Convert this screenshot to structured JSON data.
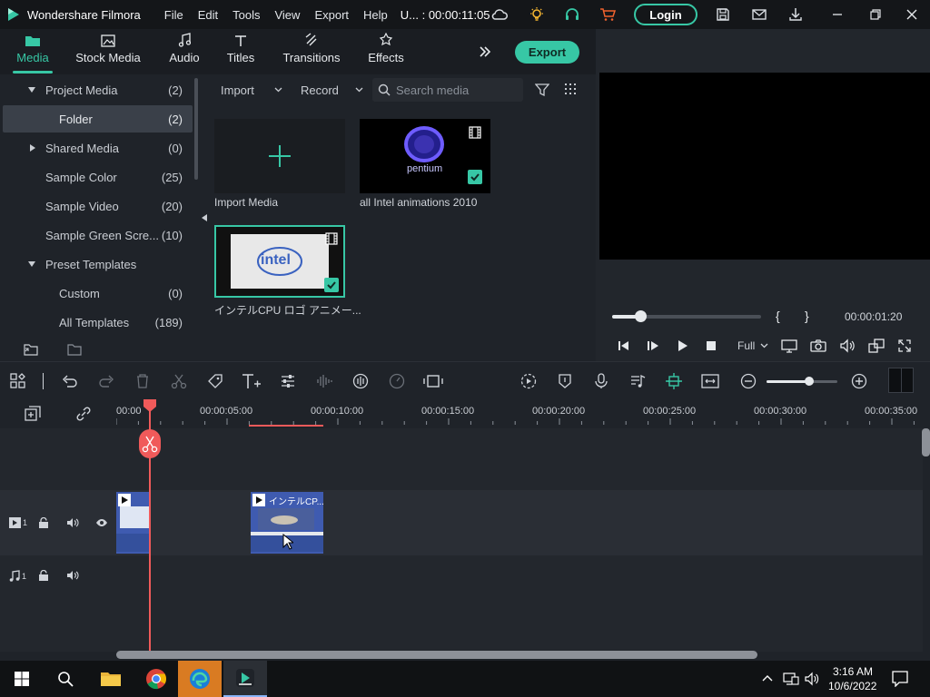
{
  "titlebar": {
    "app_name": "Wondershare Filmora",
    "menu": [
      "File",
      "Edit",
      "Tools",
      "View",
      "Export",
      "Help"
    ],
    "project_timecode": "U... : 00:00:11:05",
    "login_label": "Login"
  },
  "tabs": [
    {
      "label": "Media",
      "icon": "folder-icon",
      "active": true
    },
    {
      "label": "Stock Media",
      "icon": "image-icon",
      "active": false
    },
    {
      "label": "Audio",
      "icon": "music-note-icon",
      "active": false
    },
    {
      "label": "Titles",
      "icon": "text-t-icon",
      "active": false
    },
    {
      "label": "Transitions",
      "icon": "transitions-icon",
      "active": false
    },
    {
      "label": "Effects",
      "icon": "effects-icon",
      "active": false
    }
  ],
  "export_label": "Export",
  "sidebar": {
    "items": [
      {
        "label": "Project Media",
        "count": "(2)",
        "caret": "down"
      },
      {
        "label": "Folder",
        "count": "(2)",
        "selected": true
      },
      {
        "label": "Shared Media",
        "count": "(0)",
        "caret": "right"
      },
      {
        "label": "Sample Color",
        "count": "(25)"
      },
      {
        "label": "Sample Video",
        "count": "(20)"
      },
      {
        "label": "Sample Green Scre...",
        "count": "(10)"
      },
      {
        "label": "Preset Templates",
        "count": "",
        "caret": "down"
      },
      {
        "label": "Custom",
        "count": "(0)"
      },
      {
        "label": "All Templates",
        "count": "(189)"
      }
    ]
  },
  "media_toolbar": {
    "import_label": "Import",
    "record_label": "Record",
    "search_placeholder": "Search media"
  },
  "media_items": [
    {
      "label": "Import Media"
    },
    {
      "label": "all Intel animations 2010",
      "thumb_text": "pentium"
    },
    {
      "label": "インテルCPU ロゴ アニメー...",
      "thumb_text": "intel"
    }
  ],
  "player": {
    "timecode": "00:00:01:20",
    "progress": 0.19,
    "quality": "Full",
    "bracket_in": "{",
    "bracket_out": "}"
  },
  "timeline": {
    "ruler_ticks": [
      "00:00",
      "00:00:05:00",
      "00:00:10:00",
      "00:00:15:00",
      "00:00:20:00",
      "00:00:25:00",
      "00:00:30:00",
      "00:00:35:00"
    ],
    "video_track_label": "1",
    "audio_track_label": "1",
    "clip_title": "インテルCP...",
    "zoom_level": 0.6
  },
  "taskbar": {
    "time": "3:16 AM",
    "date": "10/6/2022"
  },
  "colors": {
    "accent": "#37c7a5",
    "playhead": "#f05a5a",
    "clip": "#3f5bb0"
  }
}
